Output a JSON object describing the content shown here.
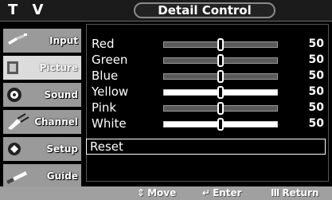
{
  "header": {
    "tv_label": "T V",
    "title": "Detail Control"
  },
  "sidebar": {
    "items": [
      {
        "label": "Input",
        "icon": "input-plug-icon",
        "active": false
      },
      {
        "label": "Picture",
        "icon": "picture-icon",
        "active": true
      },
      {
        "label": "Sound",
        "icon": "speaker-icon",
        "active": false
      },
      {
        "label": "Channel",
        "icon": "antenna-icon",
        "active": false
      },
      {
        "label": "Setup",
        "icon": "setup-icon",
        "active": false
      },
      {
        "label": "Guide",
        "icon": "guide-icon",
        "active": false
      }
    ]
  },
  "menu": {
    "rows": [
      {
        "label": "Red",
        "value": "50",
        "level": 0.5,
        "track_style": "gray"
      },
      {
        "label": "Green",
        "value": "50",
        "level": 0.5,
        "track_style": "gray"
      },
      {
        "label": "Blue",
        "value": "50",
        "level": 0.5,
        "track_style": "gray"
      },
      {
        "label": "Yellow",
        "value": "50",
        "level": 0.5,
        "track_style": "white"
      },
      {
        "label": "Pink",
        "value": "50",
        "level": 0.5,
        "track_style": "gray"
      },
      {
        "label": "White",
        "value": "50",
        "level": 0.5,
        "track_style": "white"
      }
    ],
    "reset_label": "Reset"
  },
  "footer": {
    "move_label": "Move",
    "enter_label": "Enter",
    "return_label": "Return",
    "move_glyph": "⇕",
    "enter_glyph": "↵",
    "return_glyph": "Ⅲ"
  },
  "colors": {
    "sidebar_bg": "#9a9a9a",
    "sidebar_active_bg": "#dcdcdc",
    "footer_bg": "#a0a0a0",
    "screen_bg": "#000000",
    "text": "#ffffff"
  }
}
